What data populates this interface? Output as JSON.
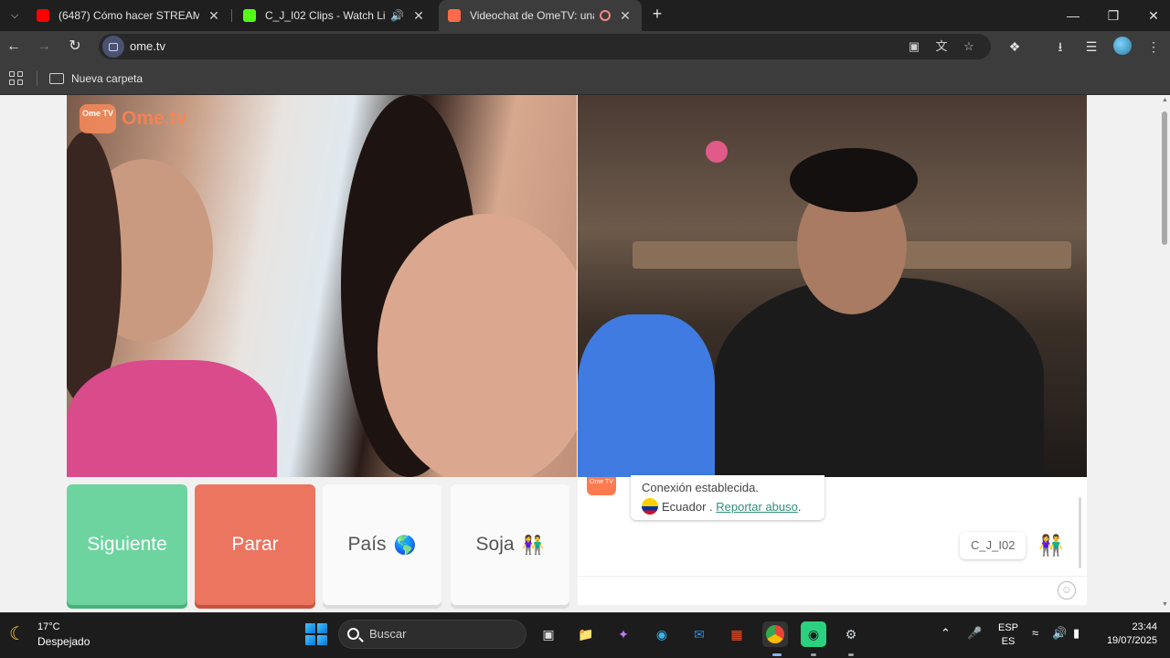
{
  "browser": {
    "tabs": [
      {
        "title": "(6487) Cómo hacer STREAM en",
        "favicon_color": "#ff0000",
        "icon": "youtube-icon"
      },
      {
        "title": "C_J_I02 Clips - Watch Live o",
        "favicon_color": "#53fc18",
        "icon": "kick-icon"
      },
      {
        "title": "Videochat de OmeTV: una n",
        "favicon_color": "#ff6b4a",
        "icon": "ometv-icon"
      }
    ],
    "url": "ome.tv",
    "bookmark_folder": "Nueva carpeta"
  },
  "page": {
    "logo_badge": "Ome TV",
    "logo_text": "Ome.tv",
    "buttons": {
      "next": "Siguiente",
      "stop": "Parar",
      "country": "País",
      "country_emoji": "🌎",
      "gender": "Soja",
      "gender_emoji": "👫"
    },
    "chat": {
      "bot_badge": "Ome TV",
      "status": "Conexión establecida.",
      "country": "Ecuador",
      "separator": " . ",
      "report": "Reportar abuso",
      "report_end": ".",
      "user_tag": "C_J_I02",
      "user_emoji": "👫",
      "smiley": "☺"
    }
  },
  "taskbar": {
    "temperature": "17°C",
    "weather": "Despejado",
    "search_placeholder": "Buscar",
    "language_top": "ESP",
    "language_bottom": "ES",
    "time": "23:44",
    "date": "19/07/2025"
  },
  "colors": {
    "next": "#6dd49f",
    "stop": "#ec7560",
    "brand": "#ff7a50",
    "link": "#2f8f7f"
  }
}
